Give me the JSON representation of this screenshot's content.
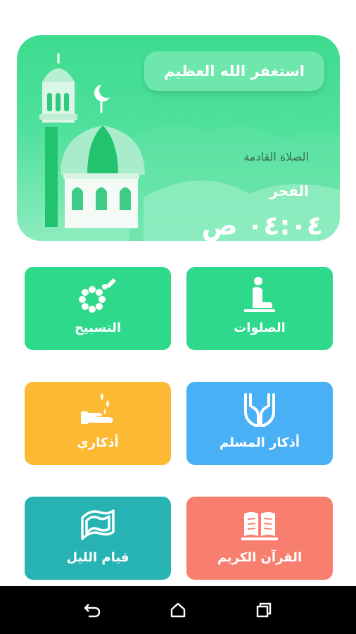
{
  "hero": {
    "dhikr": "استغفر الله العظيم",
    "next_prayer_label": "الصلاة القادمة",
    "next_prayer_name": "الفجر",
    "next_prayer_time": "٠٤:٠٤ ص"
  },
  "tiles": {
    "tasbih": "التسبيح",
    "prayers": "الصلوات",
    "adhkari": "أذكاري",
    "muslim_adhkar": "أذكار المسلم",
    "night_prayer": "قيام الليل",
    "quran": "القرآن الكريم"
  },
  "colors": {
    "green": "#2ed98b",
    "yellow": "#fbb934",
    "blue": "#4ab0f5",
    "teal": "#27b3b3",
    "salmon": "#f87f70"
  },
  "icons": {
    "tasbih": "prayer-beads-icon",
    "prayers": "praying-person-icon",
    "adhkari": "hand-water-drops-icon",
    "muslim_adhkar": "praying-hands-icon",
    "night_prayer": "prayer-mat-icon",
    "quran": "open-book-icon"
  }
}
